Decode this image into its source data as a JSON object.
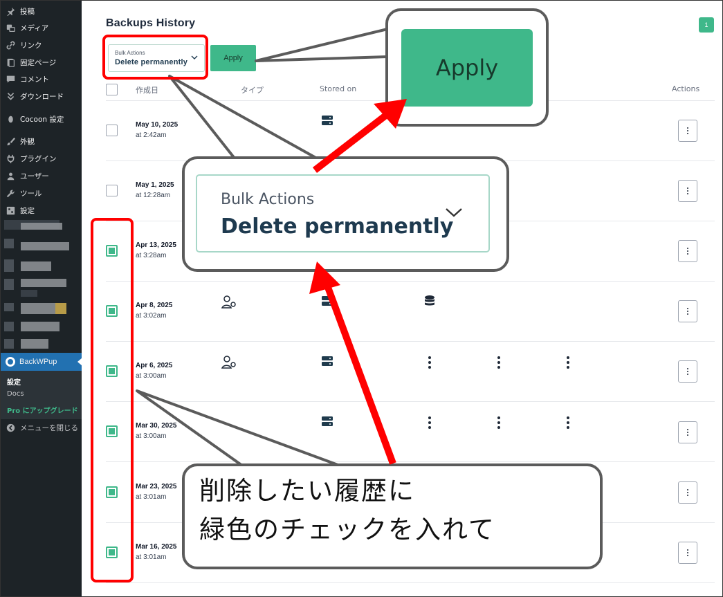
{
  "sidebar": {
    "items": [
      {
        "label": "投稿",
        "icon": "pin-icon"
      },
      {
        "label": "メディア",
        "icon": "media-icon"
      },
      {
        "label": "リンク",
        "icon": "link-icon"
      },
      {
        "label": "固定ページ",
        "icon": "page-icon"
      },
      {
        "label": "コメント",
        "icon": "comment-icon"
      },
      {
        "label": "ダウンロード",
        "icon": "download-icon"
      },
      {
        "label": "Cocoon 設定",
        "icon": "cocoon-icon"
      },
      {
        "label": "外観",
        "icon": "brush-icon"
      },
      {
        "label": "プラグイン",
        "icon": "plugin-icon"
      },
      {
        "label": "ユーザー",
        "icon": "user-icon"
      },
      {
        "label": "ツール",
        "icon": "wrench-icon"
      },
      {
        "label": "設定",
        "icon": "settings-icon"
      }
    ],
    "active_plugin": "BackWPup",
    "submenu": {
      "settings": "設定",
      "docs": "Docs",
      "pro": "Pro にアップグレード"
    },
    "collapse": "メニューを閉じる"
  },
  "colors": {
    "accent": "#3fb88a",
    "annotation_red": "#ff0000",
    "sidebar_bg": "#1d2327",
    "active_blue": "#2271b1"
  },
  "main": {
    "title": "Backups History",
    "page_badge": "1",
    "bulk_actions": {
      "label": "Bulk Actions",
      "value": "Delete permanently"
    },
    "apply_label": "Apply",
    "columns": [
      "作成日",
      "タイプ",
      "Stored on",
      "Actions"
    ],
    "rows": [
      {
        "date": "May 10, 2025",
        "time": "at 2:42am",
        "checked": false
      },
      {
        "date": "May 1, 2025",
        "time": "at 12:28am",
        "checked": false
      },
      {
        "date": "Apr 13, 2025",
        "time": "at 3:28am",
        "checked": true
      },
      {
        "date": "Apr 8, 2025",
        "time": "at 3:02am",
        "checked": true
      },
      {
        "date": "Apr 6, 2025",
        "time": "at 3:00am",
        "checked": true
      },
      {
        "date": "Mar 30, 2025",
        "time": "at 3:00am",
        "checked": true
      },
      {
        "date": "Mar 23, 2025",
        "time": "at 3:01am",
        "checked": true
      },
      {
        "date": "Mar 16, 2025",
        "time": "at 3:01am",
        "checked": true
      }
    ]
  },
  "annotations": {
    "apply_zoom": "Apply",
    "select_zoom_label": "Bulk Actions",
    "select_zoom_value": "Delete permanently",
    "note_line1": "削除したい履歴に",
    "note_line2": "緑色のチェックを入れて"
  }
}
